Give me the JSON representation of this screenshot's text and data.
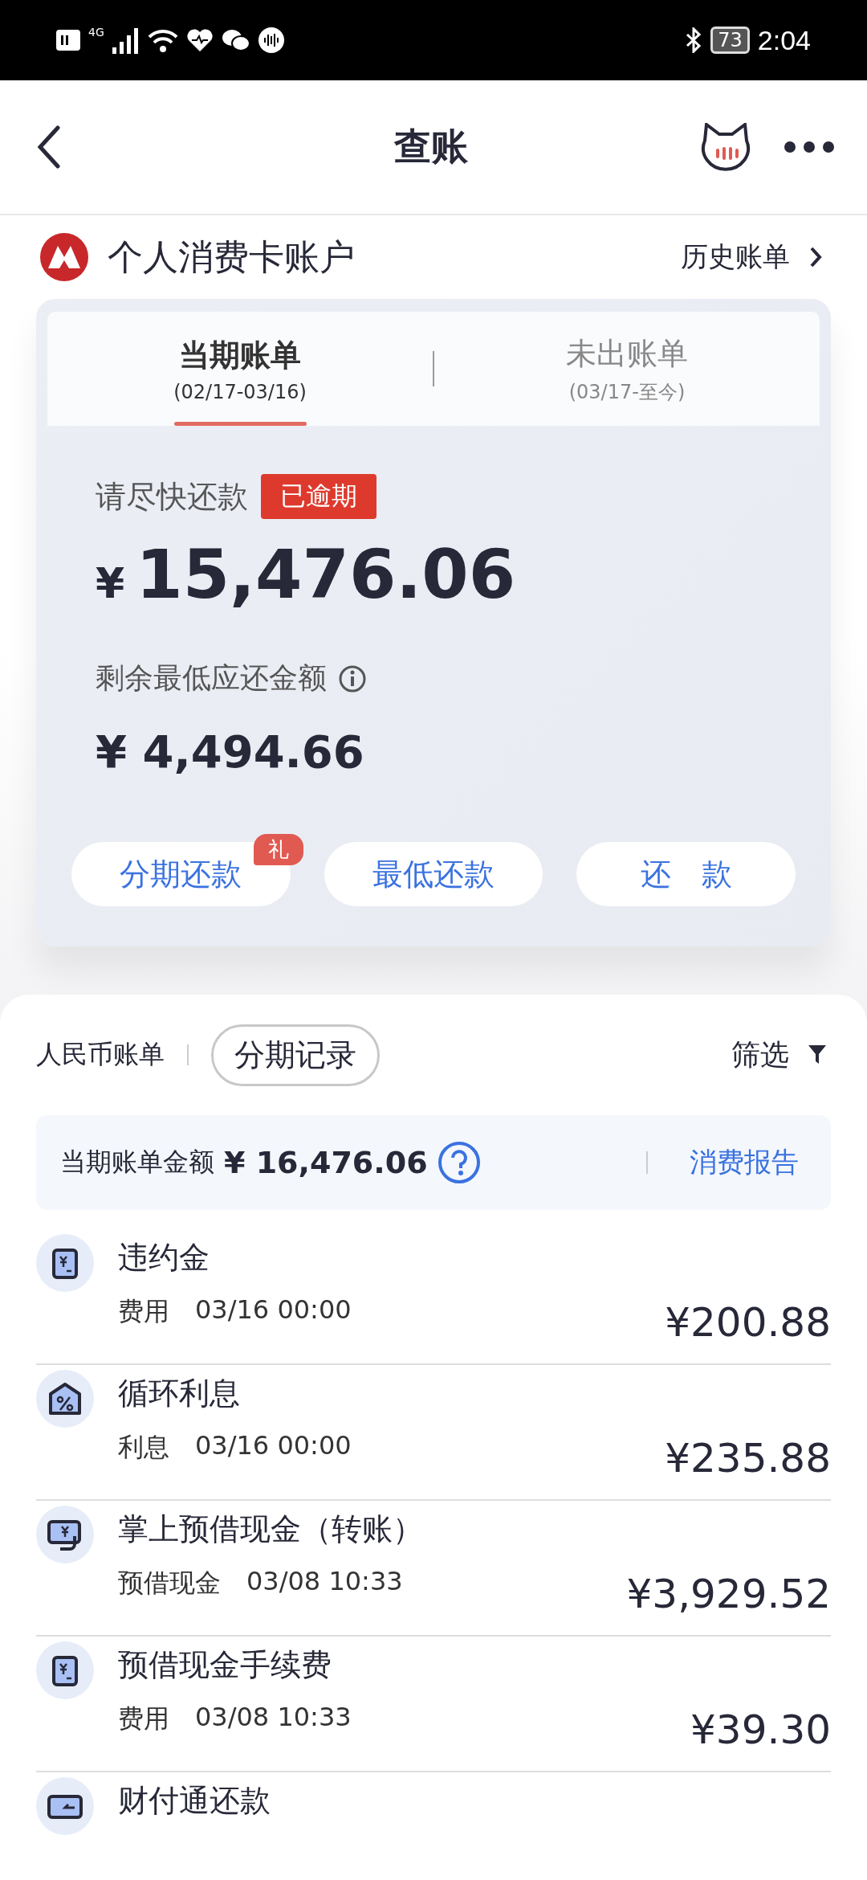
{
  "status_bar": {
    "network": "4G",
    "battery": "73",
    "time": "2:04"
  },
  "header": {
    "title": "查账"
  },
  "account": {
    "name": "个人消费卡账户",
    "history_link": "历史账单"
  },
  "bill_tabs": [
    {
      "label": "当期账单",
      "period": "(02/17-03/16)",
      "selected": true
    },
    {
      "label": "未出账单",
      "period": "(03/17-至今)",
      "selected": false
    }
  ],
  "bill": {
    "prompt": "请尽快还款",
    "badge": "已逾期",
    "currency": "¥",
    "amount": "15,476.06",
    "min_label": "剩余最低应还金额",
    "min_amount": "¥ 4,494.66"
  },
  "actions": [
    {
      "label": "分期还款",
      "badge": "礼"
    },
    {
      "label": "最低还款"
    },
    {
      "label": "还　款"
    }
  ],
  "filters": {
    "currency_label": "人民币账单",
    "installments_button": "分期记录",
    "filter_label": "筛选"
  },
  "summary": {
    "label": "当期账单金额",
    "amount": "¥ 16,476.06",
    "report_link": "消费报告"
  },
  "transactions": [
    {
      "kind": "fee",
      "title": "违约金",
      "category": "费用",
      "time": "03/16 00:00",
      "amount": "¥200.88"
    },
    {
      "kind": "interest",
      "title": "循环利息",
      "category": "利息",
      "time": "03/16 00:00",
      "amount": "¥235.88"
    },
    {
      "kind": "cash",
      "title": "掌上预借现金（转账）",
      "category": "预借现金",
      "time": "03/08 10:33",
      "amount": "¥3,929.52"
    },
    {
      "kind": "fee",
      "title": "预借现金手续费",
      "category": "费用",
      "time": "03/08 10:33",
      "amount": "¥39.30"
    },
    {
      "kind": "repay",
      "title": "财付通还款"
    }
  ]
}
